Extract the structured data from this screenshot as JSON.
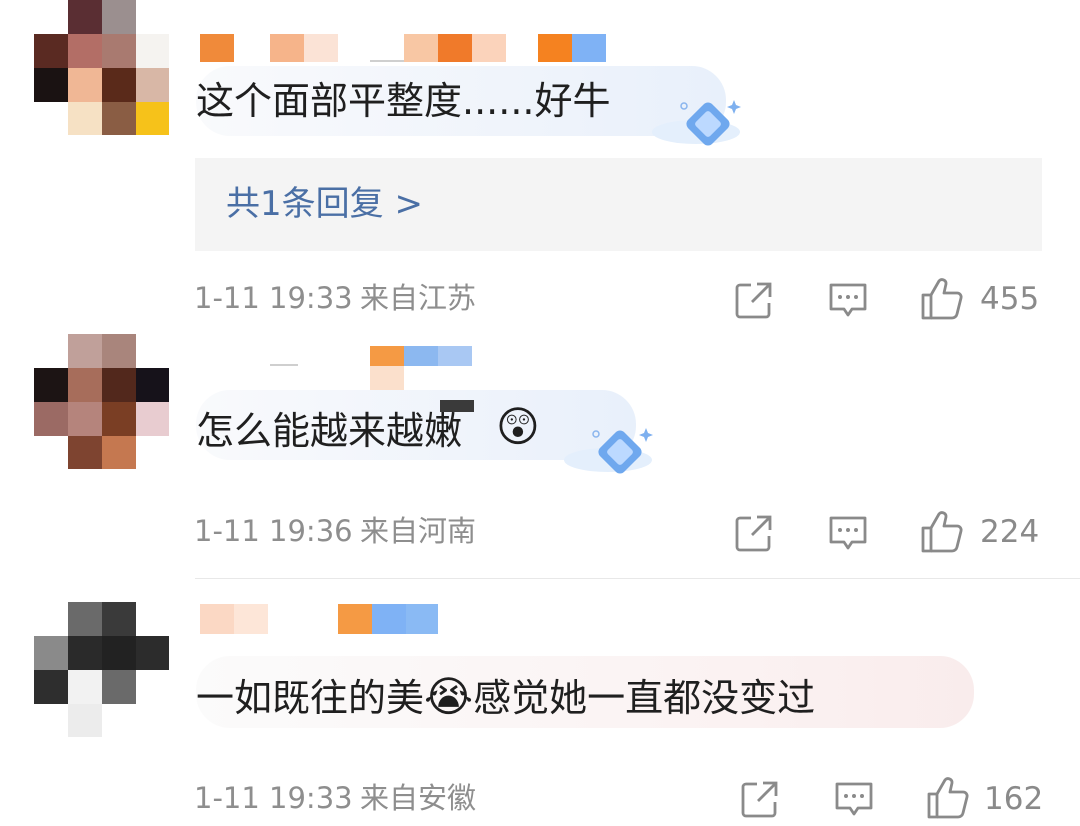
{
  "comments": [
    {
      "text": "这个面部平整度......好牛",
      "timestamp": "1-11 19:33",
      "location": "来自江苏",
      "likes": "455",
      "reply_link": "共1条回复 >"
    },
    {
      "text": "怎么能越来越嫩",
      "emoji": "😲",
      "timestamp": "1-11 19:36",
      "location": "来自河南",
      "likes": "224"
    },
    {
      "text_before": "一如既往的美",
      "emoji": "😭",
      "text_after": "感觉她一直都没变过",
      "timestamp": "1-11 19:33",
      "location": "来自安徽",
      "likes": "162"
    }
  ],
  "icons": [
    "share-icon",
    "comment-icon",
    "like-icon",
    "diamond-badge-icon"
  ],
  "colors": {
    "text": "#1f1f1f",
    "meta": "#8e8e8e",
    "link": "#4a6fa5",
    "reply_bg": "#f4f4f4"
  }
}
